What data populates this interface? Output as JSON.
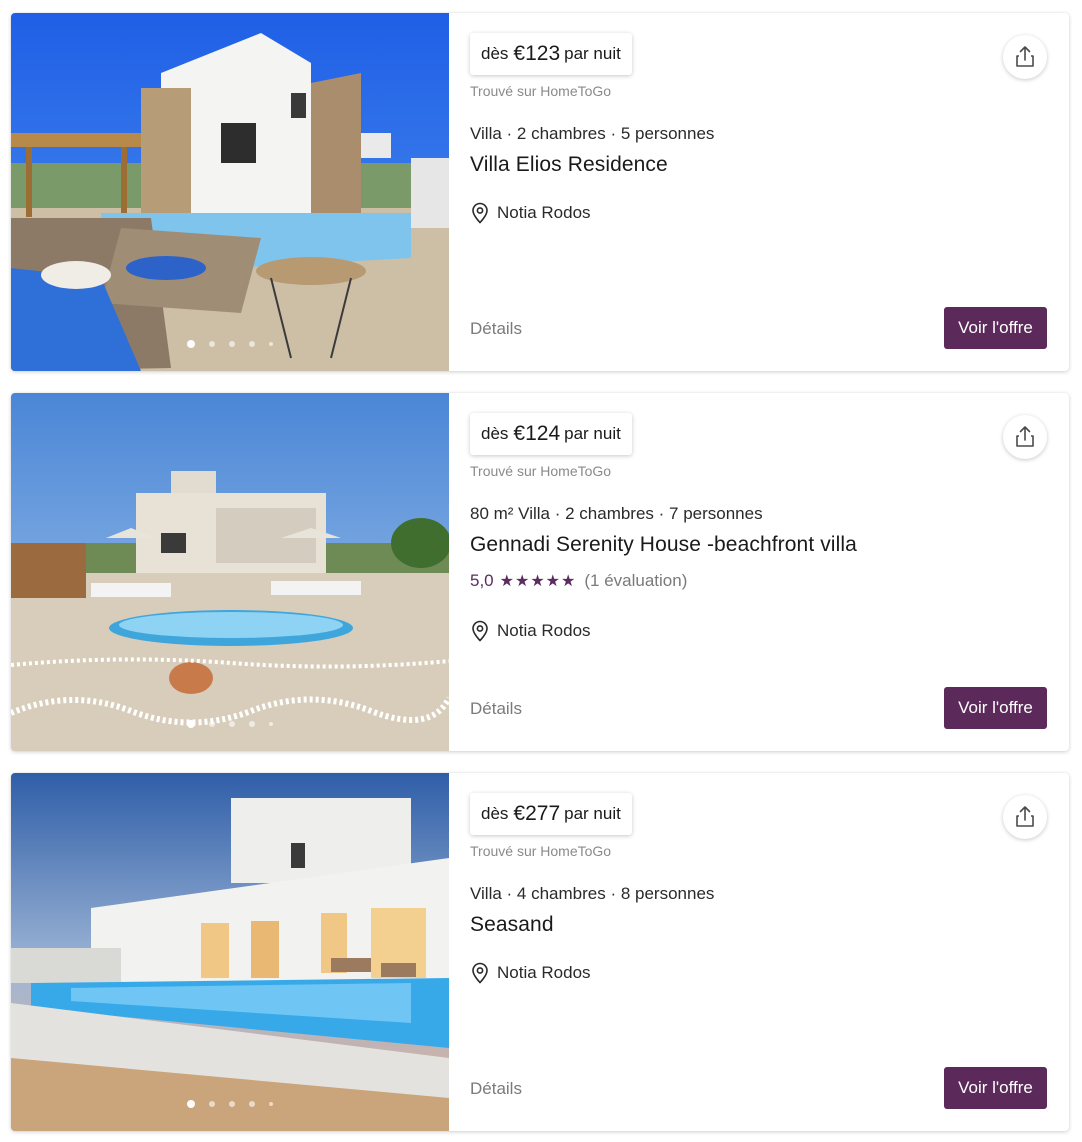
{
  "listings": [
    {
      "price_prefix": "dès",
      "price": "€123",
      "price_suffix": "par nuit",
      "source": "Trouvé sur HomeToGo",
      "specs": "Villa · 2 chambres · 5 personnes",
      "title": "Villa Elios Residence",
      "location": "Notia Rodos",
      "details_label": "Détails",
      "cta_label": "Voir l'offre",
      "photo_count_dots": 5
    },
    {
      "price_prefix": "dès",
      "price": "€124",
      "price_suffix": "par nuit",
      "source": "Trouvé sur HomeToGo",
      "specs": "80 m² Villa · 2 chambres · 7 personnes",
      "title": "Gennadi Serenity House -beachfront villa",
      "rating_value": "5,0",
      "rating_stars": "★★★★★",
      "rating_count": "(1 évaluation)",
      "location": "Notia Rodos",
      "details_label": "Détails",
      "cta_label": "Voir l'offre",
      "photo_count_dots": 5
    },
    {
      "price_prefix": "dès",
      "price": "€277",
      "price_suffix": "par nuit",
      "source": "Trouvé sur HomeToGo",
      "specs": "Villa · 4 chambres · 8 personnes",
      "title": "Seasand",
      "location": "Notia Rodos",
      "details_label": "Détails",
      "cta_label": "Voir l'offre",
      "photo_count_dots": 5
    }
  ],
  "colors": {
    "accent": "#5c2a5a",
    "rating": "#5a2d5e",
    "muted_text": "#8a8a8a"
  },
  "icons": {
    "share": "share-icon",
    "location": "location-pin-icon"
  }
}
